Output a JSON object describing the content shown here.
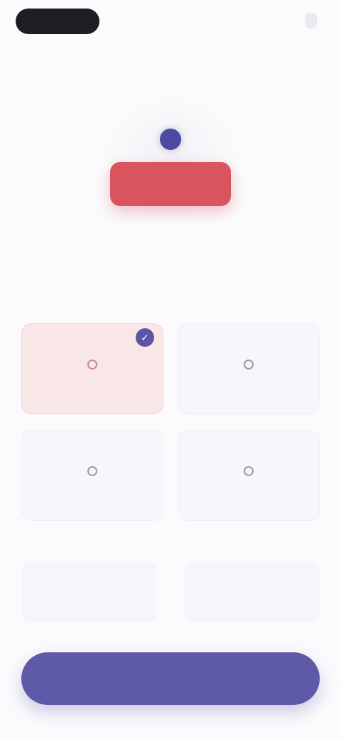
{
  "header": {
    "left_pill": "",
    "right_label": ""
  },
  "hero": {
    "banner_text": "",
    "title": "",
    "subtitle_line1": "",
    "subtitle_line2": ""
  },
  "options": [
    {
      "label": "",
      "icon": "circle-icon",
      "selected": true
    },
    {
      "label": "",
      "icon": "circle-icon",
      "selected": false
    },
    {
      "label": "",
      "icon": "circle-icon",
      "selected": false
    },
    {
      "label": "",
      "icon": "circle-icon",
      "selected": false
    }
  ],
  "stats": [
    {
      "key": "",
      "value": ""
    },
    {
      "key": "",
      "value": ""
    }
  ],
  "cta": {
    "label": ""
  },
  "colors": {
    "accent": "#5f5aa8",
    "banner": "#d9545e",
    "selected_card": "#f9e6e6"
  }
}
